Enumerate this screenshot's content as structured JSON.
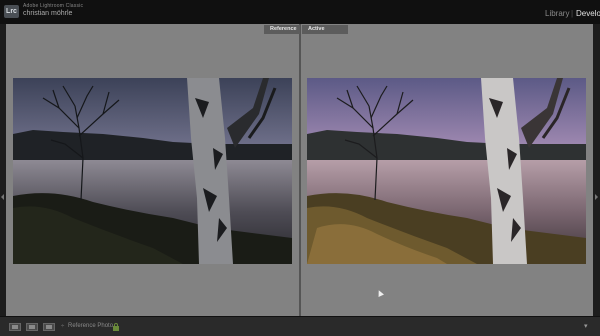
{
  "header": {
    "logo_text": "Lrc",
    "app_name": "Adobe Lightroom Classic",
    "user_name": "christian möhrle",
    "modules": [
      "Library",
      "|",
      "Develop"
    ]
  },
  "viewer": {
    "reference_label": "Reference",
    "active_label": "Active",
    "background_color": "#828282"
  },
  "toolbar": {
    "separator": "÷",
    "reference_photo_label": "Reference Photo",
    "dropdown_icon": "▾",
    "lock_icon": "lock-icon"
  },
  "edge_panels": {
    "left_icon": "triangle-left",
    "right_icon": "triangle-right"
  }
}
